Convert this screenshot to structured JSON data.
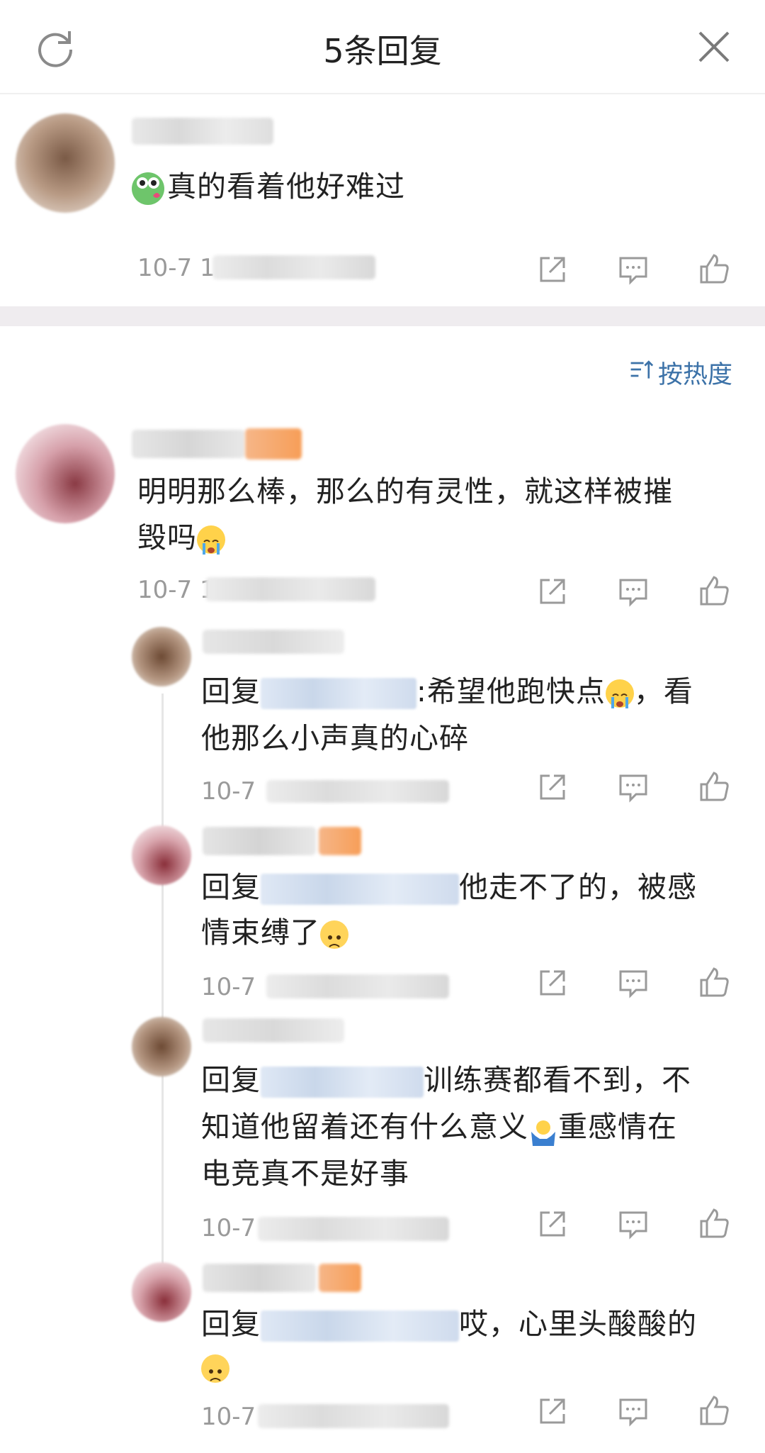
{
  "header": {
    "title": "5条回复"
  },
  "main_comment": {
    "text": "真的看着他好难过",
    "time": "10-7 1"
  },
  "sort": {
    "label": "按热度"
  },
  "top_comment": {
    "text_line1": "明明那么棒，那么的有灵性，就这样被摧",
    "text_line2": "毁吗",
    "time": "10-7 1"
  },
  "replies": [
    {
      "prefix": "回复",
      "text_a": ":希望他跑快点",
      "text_b": "，看",
      "line2": "他那么小声真的心碎",
      "time": "10-7"
    },
    {
      "prefix": "回复",
      "text_a": "他走不了的，被感",
      "line2": "情束缚了",
      "time": "10-7"
    },
    {
      "prefix": "回复",
      "text_a": "训练赛都看不到，不",
      "line2a": "知道他留着还有什么意义",
      "line2b": "重感情在",
      "line3": "电竞真不是好事",
      "time": "10-7"
    },
    {
      "prefix": "回复",
      "text_a": "哎，心里头酸酸的",
      "time": "10-7"
    }
  ],
  "colors": {
    "accent": "#3c72a8",
    "divider": "#efecef",
    "meta": "#9a9a9a"
  },
  "icons": [
    "refresh-icon",
    "close-icon",
    "share-icon",
    "comment-icon",
    "like-icon",
    "sort-icon"
  ]
}
